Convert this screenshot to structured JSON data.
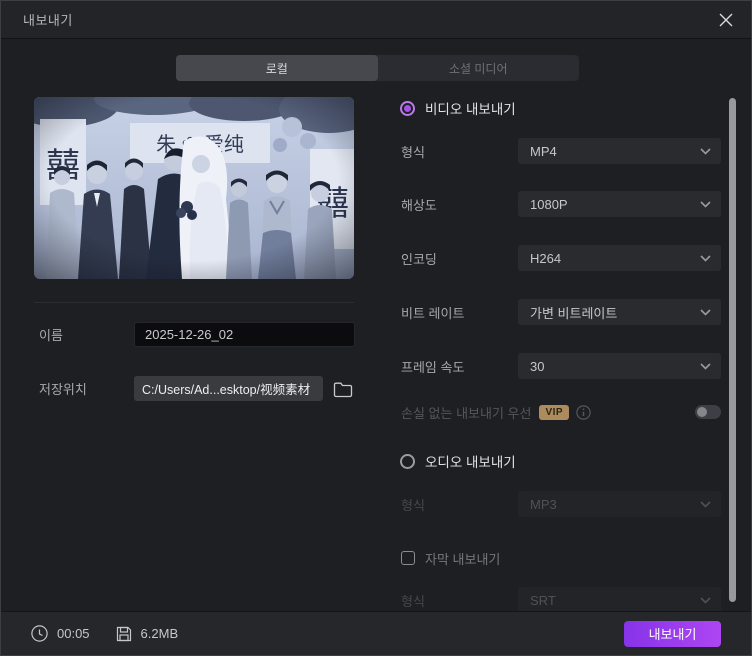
{
  "window": {
    "title": "내보내기"
  },
  "tabs": {
    "local": "로컬",
    "social": "소셜 미디어"
  },
  "left": {
    "name_label": "이름",
    "name_value": "2025-12-26_02",
    "location_label": "저장위치",
    "location_value": "C:/Users/Ad...esktop/视频素材"
  },
  "thumbnail": {
    "banner_glyph": "囍"
  },
  "video": {
    "radio_label": "비디오 내보내기",
    "rows": [
      {
        "label": "형식",
        "value": "MP4"
      },
      {
        "label": "해상도",
        "value": "1080P"
      },
      {
        "label": "인코딩",
        "value": "H264"
      },
      {
        "label": "비트 레이트",
        "value": "가변 비트레이트"
      },
      {
        "label": "프레임 속도",
        "value": "30"
      }
    ],
    "lossless_label": "손실 없는 내보내기 우선",
    "vip_badge": "VIP"
  },
  "audio": {
    "radio_label": "오디오 내보내기",
    "format_label": "형식",
    "format_value": "MP3"
  },
  "subtitle": {
    "checkbox_label": "자막 내보내기",
    "format_label": "형식",
    "format_value": "SRT"
  },
  "footer": {
    "duration": "00:05",
    "size": "6.2MB",
    "export_button": "내보내기"
  },
  "colors": {
    "accent": "#a453ea",
    "button_gradient_start": "#8733e8",
    "button_gradient_end": "#ad46f2",
    "vip_badge_bg": "#ad8b5c"
  }
}
